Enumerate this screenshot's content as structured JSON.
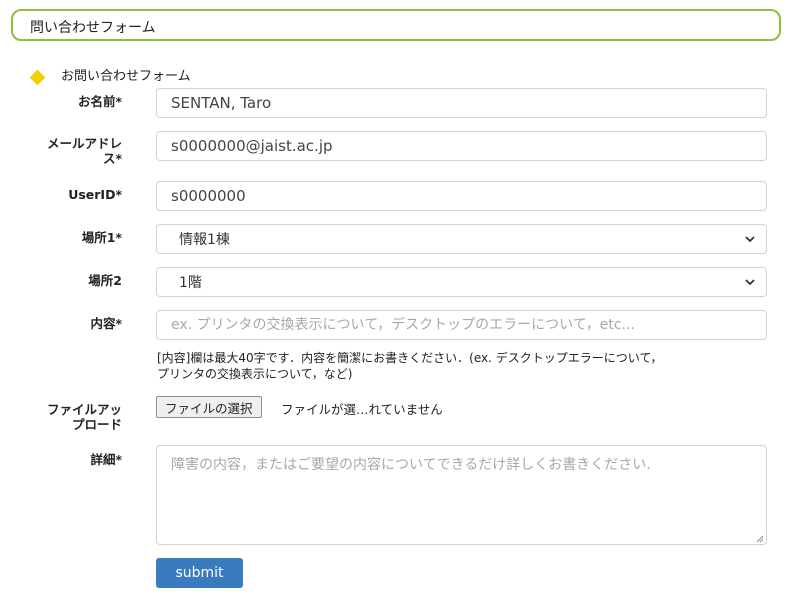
{
  "header": {
    "title": "問い合わせフォーム"
  },
  "section": {
    "heading": "お問い合わせフォーム"
  },
  "form": {
    "name": {
      "label": "お名前*",
      "value": "SENTAN, Taro"
    },
    "email": {
      "label_line1": "メールアドレ",
      "label_line2": "ス*",
      "value": "s0000000@jaist.ac.jp"
    },
    "userid": {
      "label": "UserID*",
      "value": "s0000000"
    },
    "location1": {
      "label": "場所1*",
      "selected": "情報1棟"
    },
    "location2": {
      "label": "場所2",
      "selected": "1階"
    },
    "content": {
      "label": "内容*",
      "placeholder": "ex. プリンタの交換表示について，デスクトップのエラーについて，etc...",
      "help_line1": "[内容]欄は最大40字です．内容を簡潔にお書きください．(ex. デスクトップエラーについて，",
      "help_line2": "プリンタの交換表示について，など)"
    },
    "file_upload": {
      "label_line1": "ファイルアッ",
      "label_line2": "プロード",
      "button_label": "ファイルの選択",
      "status": "ファイルが選…れていません"
    },
    "details": {
      "label": "詳細*",
      "placeholder": "障害の内容，またはご要望の内容についてできるだけ詳しくお書きください."
    },
    "submit_label": "submit"
  },
  "colors": {
    "title_border": "#8fbf3f",
    "diamond": "#f2cf00",
    "submit_bg": "#3a7bbf"
  },
  "icons": {
    "section_marker": "diamond-icon",
    "select_arrow": "chevron-down-icon",
    "textarea_grip": "resize-grip-icon"
  }
}
